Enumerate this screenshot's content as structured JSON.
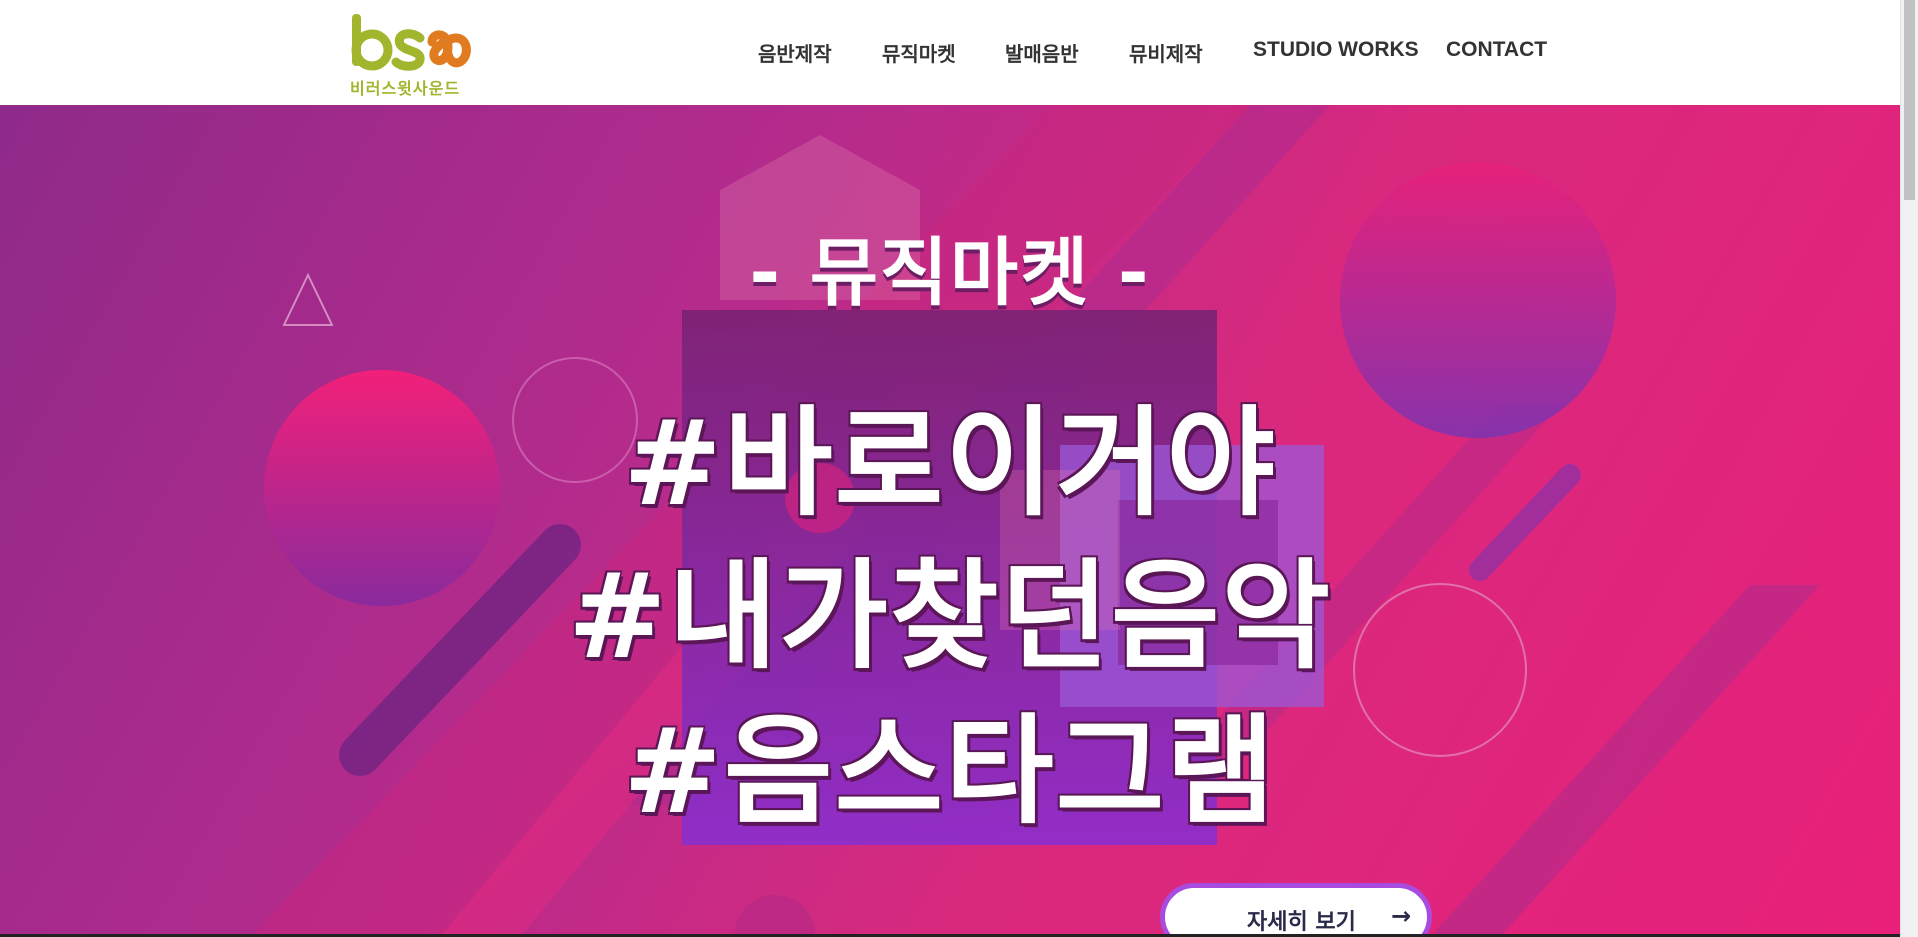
{
  "brand": {
    "logo_name": "비러스윗사운드",
    "logo_mark": "bsw",
    "colors": {
      "green": "#a3b52d",
      "orange": "#e07b1f"
    }
  },
  "nav": {
    "items": [
      {
        "label": "음반제작"
      },
      {
        "label": "뮤직마켓"
      },
      {
        "label": "발매음반"
      },
      {
        "label": "뮤비제작"
      },
      {
        "label": "STUDIO WORKS"
      },
      {
        "label": "CONTACT"
      }
    ]
  },
  "hero": {
    "subtitle": "- 뮤직마켓 -",
    "hashtags": [
      "#바로이거야",
      "#내가찾던음악",
      "#음스타그램"
    ],
    "button_label": "자세히 보기",
    "button_icon": "arrow-right-icon",
    "colors": {
      "bg_start": "#8f2a8a",
      "bg_end": "#e8207a",
      "accent_purple": "#8a34d8",
      "button_border": "#a84ce0"
    }
  }
}
